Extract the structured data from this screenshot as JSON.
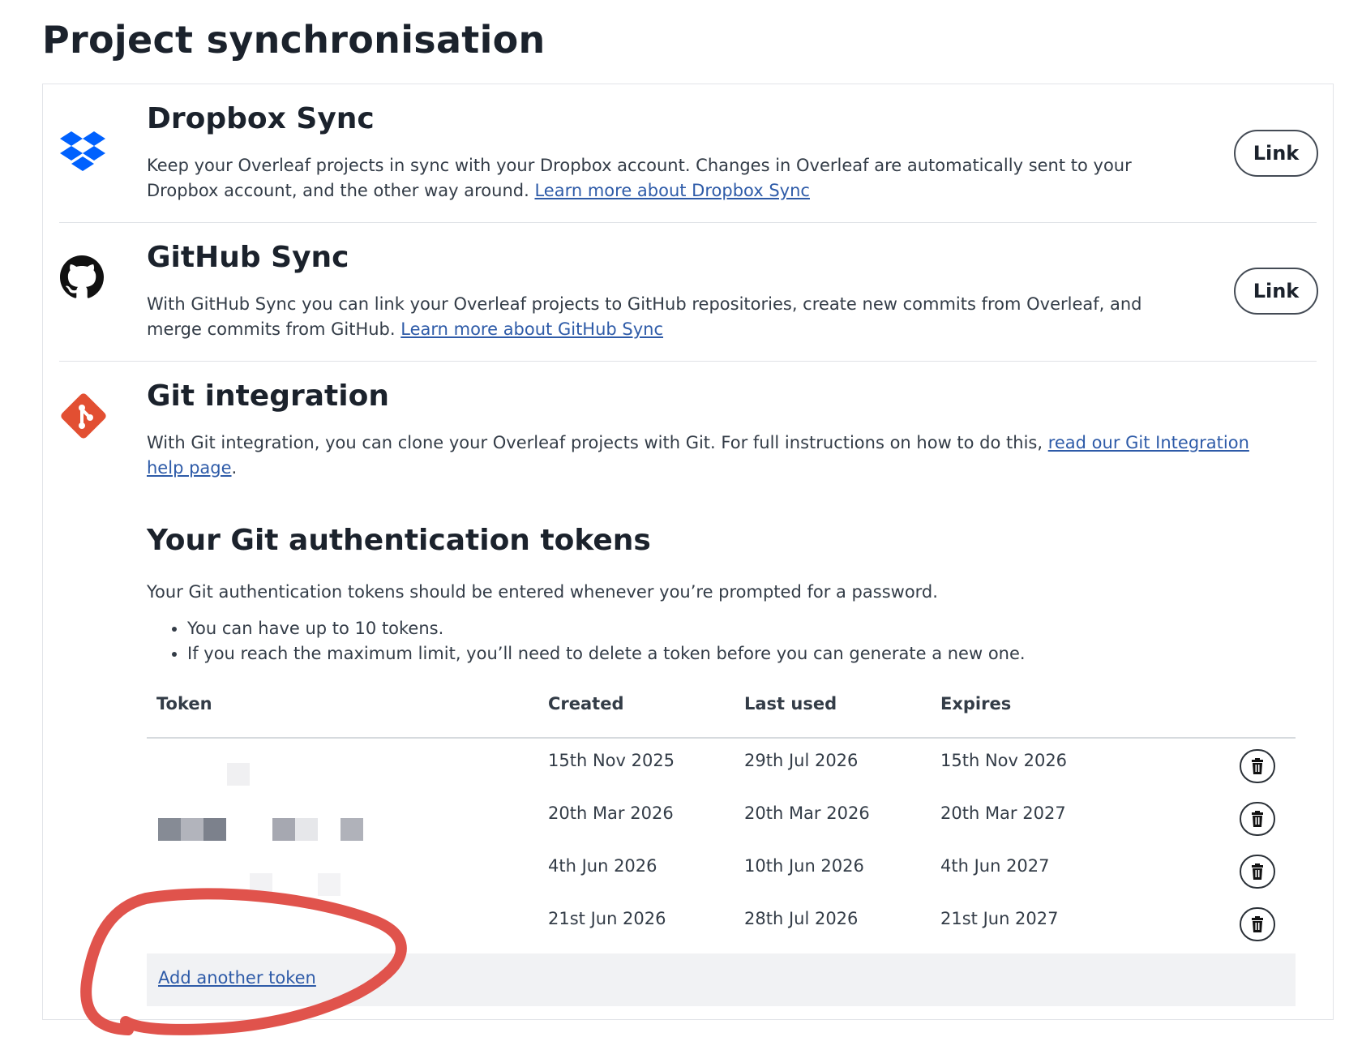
{
  "page": {
    "title": "Project synchronisation"
  },
  "dropbox": {
    "icon": "dropbox-icon",
    "title": "Dropbox Sync",
    "description": "Keep your Overleaf projects in sync with your Dropbox account. Changes in Overleaf are automatically sent to your Dropbox account, and the other way around.",
    "learn_more": "Learn more about Dropbox Sync",
    "button_label": "Link"
  },
  "github": {
    "icon": "github-icon",
    "title": "GitHub Sync",
    "description": "With GitHub Sync you can link your Overleaf projects to GitHub repositories, create new commits from Overleaf, and merge commits from GitHub.",
    "learn_more": "Learn more about GitHub Sync",
    "button_label": "Link"
  },
  "git": {
    "icon": "git-icon",
    "title": "Git integration",
    "description": "With Git integration, you can clone your Overleaf projects with Git. For full instructions on how to do this,",
    "help_link": "read our Git Integration help page",
    "period": "."
  },
  "tokens": {
    "title": "Your Git authentication tokens",
    "intro": "Your Git authentication tokens should be entered whenever you’re prompted for a password.",
    "bullets": [
      "You can have up to 10 tokens.",
      "If you reach the maximum limit, you’ll need to delete a token before you can generate a new one."
    ],
    "columns": {
      "token": "Token",
      "created": "Created",
      "last_used": "Last used",
      "expires": "Expires"
    },
    "rows": [
      {
        "created": "15th Nov 2025",
        "last_used": "29th Jul 2026",
        "expires": "15th Nov 2026"
      },
      {
        "created": "20th Mar 2026",
        "last_used": "20th Mar 2026",
        "expires": "20th Mar 2027"
      },
      {
        "created": "4th Jun 2026",
        "last_used": "10th Jun 2026",
        "expires": "4th Jun 2027"
      },
      {
        "created": "21st Jun 2026",
        "last_used": "28th Jul 2026",
        "expires": "21st Jun 2027"
      }
    ],
    "delete_icon": "trash-icon",
    "add_link": "Add another token"
  },
  "colors": {
    "dropbox_blue": "#0061fe",
    "git_red": "#e24f32",
    "link_blue": "#2e5ba8",
    "annotation_red": "#e0534c"
  }
}
